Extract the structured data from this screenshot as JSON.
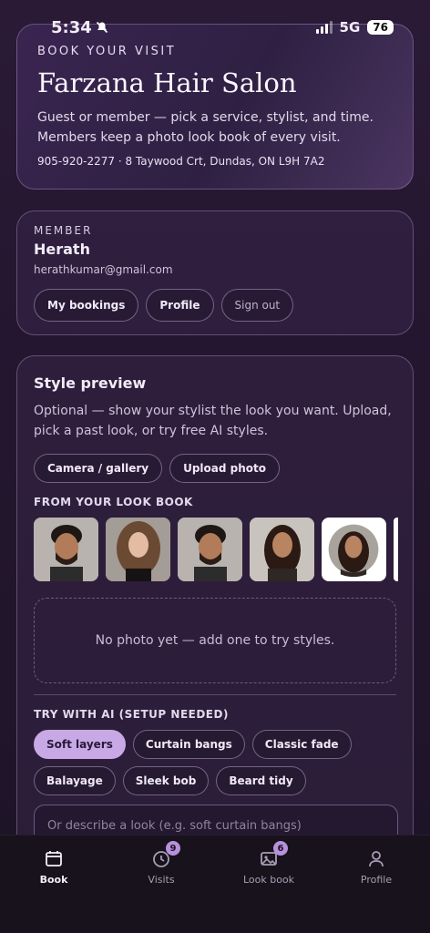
{
  "status": {
    "time": "5:34",
    "network": "5G",
    "battery": "76"
  },
  "hero": {
    "eyebrow": "BOOK YOUR VISIT",
    "title": "Farzana Hair Salon",
    "description": "Guest or member — pick a service, stylist, and time. Members keep a photo look book of every visit.",
    "contact": "905-920-2277 · 8 Taywood Crt, Dundas, ON L9H 7A2"
  },
  "member": {
    "label": "MEMBER",
    "name": "Herath",
    "email": "herathkumar@gmail.com",
    "buttons": {
      "bookings": "My bookings",
      "profile": "Profile",
      "sign_out": "Sign out"
    }
  },
  "style_preview": {
    "title": "Style preview",
    "description": "Optional — show your stylist the look you want. Upload, pick a past look, or try free AI styles.",
    "camera_label": "Camera / gallery",
    "upload_label": "Upload photo",
    "lookbook_label": "FROM YOUR LOOK BOOK",
    "empty_text": "No photo yet — add one to try styles.",
    "ai_label": "TRY WITH AI (SETUP NEEDED)",
    "chips": [
      "Soft layers",
      "Curtain bangs",
      "Classic fade",
      "Balayage",
      "Sleek bob",
      "Beard tidy"
    ],
    "active_chip": "Soft layers",
    "describe_placeholder": "Or describe a look (e.g. soft curtain bangs)"
  },
  "tabs": [
    {
      "label": "Book",
      "icon": "calendar-icon",
      "badge": ""
    },
    {
      "label": "Visits",
      "icon": "clock-icon",
      "badge": "9"
    },
    {
      "label": "Look book",
      "icon": "photos-icon",
      "badge": "6"
    },
    {
      "label": "Profile",
      "icon": "person-icon",
      "badge": ""
    }
  ],
  "colors": {
    "accent": "#c8a9e6",
    "badge": "#b691dc",
    "background": "#24162f"
  }
}
